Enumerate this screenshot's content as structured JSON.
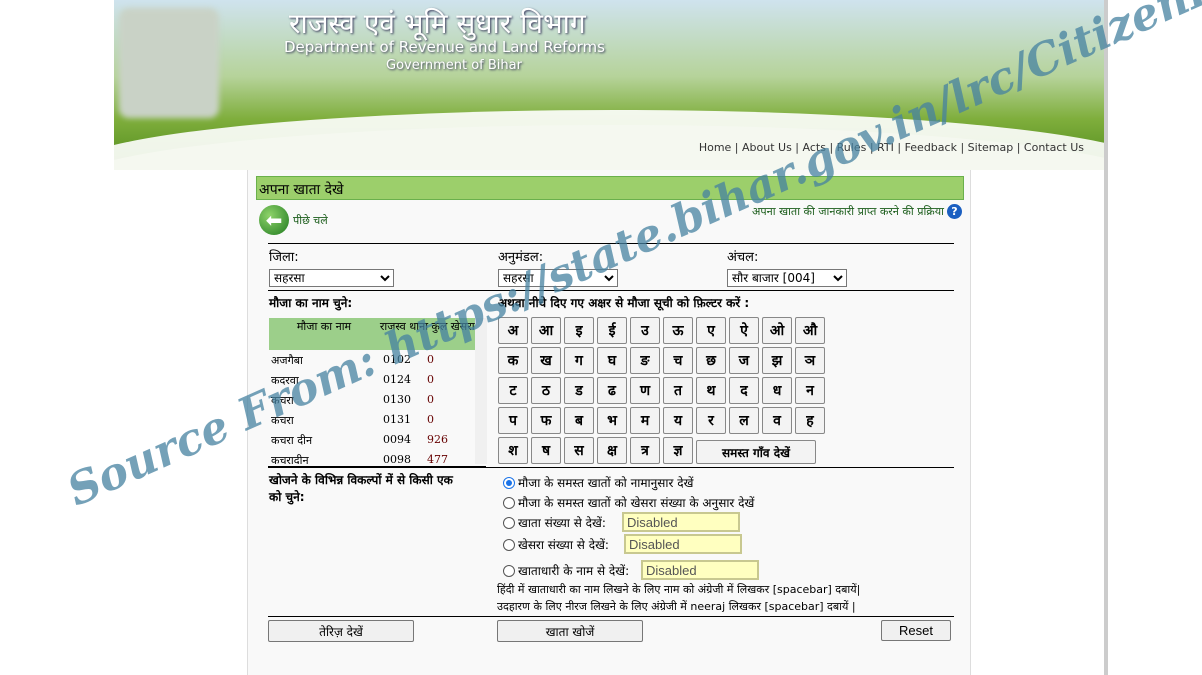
{
  "header": {
    "title_hi": "राजस्व एवं भूमि सुधार विभाग",
    "title_en": "Department of Revenue and Land Reforms",
    "subtitle": "Government of Bihar",
    "nav": [
      "Home",
      "About Us",
      "Acts",
      "Rules",
      "RTI",
      "Feedback",
      "Sitemap",
      "Contact Us"
    ]
  },
  "page": {
    "title": "अपना खाता देखे",
    "back": "पीछे चले",
    "process_link": "अपना खाता की जानकारी प्राप्त करने की प्रक्रिया"
  },
  "filters": {
    "district_label": "जिला:",
    "district": "सहरसा",
    "subdivision_label": "अनुमंडल:",
    "subdivision": "सहरसा",
    "circle_label": "अंचल:",
    "circle": "सौर बाजार [004]"
  },
  "mauja": {
    "label": "मौजा का नाम चुने:",
    "filter_label": "अथवा नीचे दिए गए अक्षर से मौजा सूची को फ़िल्टर करें :",
    "headers": [
      "मौजा का नाम",
      "राजस्व थाना",
      "कुल खेसरा"
    ],
    "rows": [
      [
        "अजगैबा",
        "0102",
        "0"
      ],
      [
        "कदरवा",
        "0124",
        "0"
      ],
      [
        "कचरा",
        "0130",
        "0"
      ],
      [
        "कचरा",
        "0131",
        "0"
      ],
      [
        "कचरा दीन",
        "0094",
        "926"
      ],
      [
        "कचरादीन",
        "0098",
        "477"
      ]
    ]
  },
  "letters": [
    "अ",
    "आ",
    "इ",
    "ई",
    "उ",
    "ऊ",
    "ए",
    "ऐ",
    "ओ",
    "औ",
    "क",
    "ख",
    "ग",
    "घ",
    "ङ",
    "च",
    "छ",
    "ज",
    "झ",
    "ञ",
    "ट",
    "ठ",
    "ड",
    "ढ",
    "ण",
    "त",
    "थ",
    "द",
    "ध",
    "न",
    "प",
    "फ",
    "ब",
    "भ",
    "म",
    "य",
    "र",
    "ल",
    "व",
    "ह",
    "श",
    "ष",
    "स",
    "क्ष",
    "त्र",
    "ज्ञ"
  ],
  "all_villages": "समस्त गाँव देखें",
  "search": {
    "label": "खोजने के विभिन्न विकल्पों में से किसी एक को चुने:",
    "options": [
      "मौजा के समस्त खातों को नामानुसार देखें",
      "मौजा के समस्त खातों को खेसरा संख्या के अनुसार देखें",
      "खाता संख्या से देखें:",
      "खेसरा संख्या से देखें:",
      "खाताधारी के नाम से देखें:"
    ],
    "selected": 0,
    "disabled_value": "Disabled",
    "note1": "हिंदी में खाताधारी का नाम लिखने के लिए नाम को अंग्रेजी में लिखकर [spacebar] दबायें|",
    "note2": "उदहारण के लिए नीरज लिखने के लिए अंग्रेजी में neeraj लिखकर [spacebar] दबायें |"
  },
  "buttons": {
    "teriz": "तेरिज़ देखें",
    "search": "खाता खोजें",
    "reset": "Reset"
  },
  "watermark": "Source From: https://state.bihar.gov.in/lrc/CitizenHome.html"
}
